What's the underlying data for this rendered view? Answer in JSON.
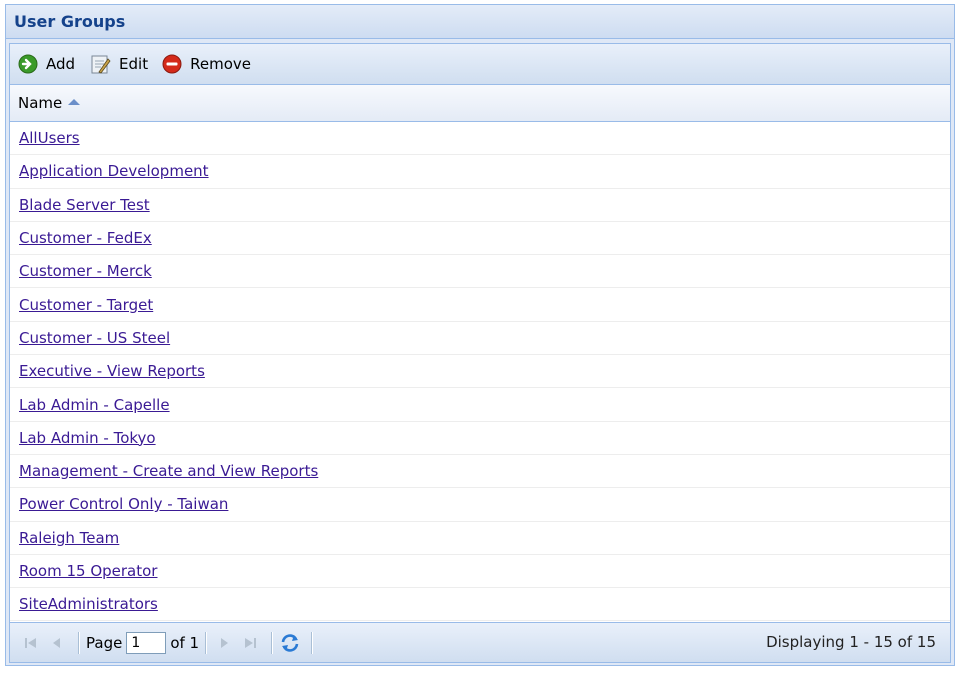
{
  "panel": {
    "title": "User Groups"
  },
  "toolbar": {
    "add_label": "Add",
    "edit_label": "Edit",
    "remove_label": "Remove"
  },
  "grid": {
    "column_header": "Name",
    "sort": "ascending",
    "rows": [
      "AllUsers",
      "Application Development",
      "Blade Server Test",
      "Customer - FedEx",
      "Customer - Merck",
      "Customer - Target",
      "Customer - US Steel",
      "Executive - View Reports",
      "Lab Admin - Capelle",
      "Lab Admin - Tokyo",
      "Management - Create and View Reports",
      "Power Control Only - Taiwan",
      "Raleigh Team",
      "Room 15 Operator",
      "SiteAdministrators"
    ]
  },
  "pager": {
    "page_label": "Page",
    "page_value": "1",
    "of_label": "of 1",
    "display_msg": "Displaying 1 - 15 of 15"
  },
  "colors": {
    "header_text": "#15428b",
    "border": "#99bbe8",
    "link": "#3a1a94"
  },
  "icons": [
    "add-icon",
    "edit-icon",
    "remove-icon",
    "sort-asc-icon",
    "first-page-icon",
    "prev-page-icon",
    "next-page-icon",
    "last-page-icon",
    "refresh-icon"
  ]
}
